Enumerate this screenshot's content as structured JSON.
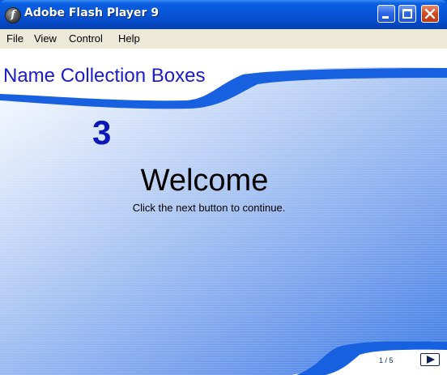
{
  "window": {
    "title": "Adobe Flash Player 9"
  },
  "menu": {
    "items": [
      "File",
      "View",
      "Control",
      "Help"
    ]
  },
  "slide": {
    "title": "Name Collection Boxes",
    "number": "3",
    "heading": "Welcome",
    "instruction": "Click the next button to continue.",
    "page_indicator": "1 / 5"
  },
  "icons": {
    "app": "flash-player-icon",
    "minimize": "minimize-icon",
    "maximize": "maximize-icon",
    "close": "close-icon",
    "next": "play-next-icon"
  },
  "colors": {
    "title_text": "#1a1ad0",
    "number_text": "#0d18b8",
    "titlebar": "#0752d4",
    "close_button": "#d3461d"
  }
}
